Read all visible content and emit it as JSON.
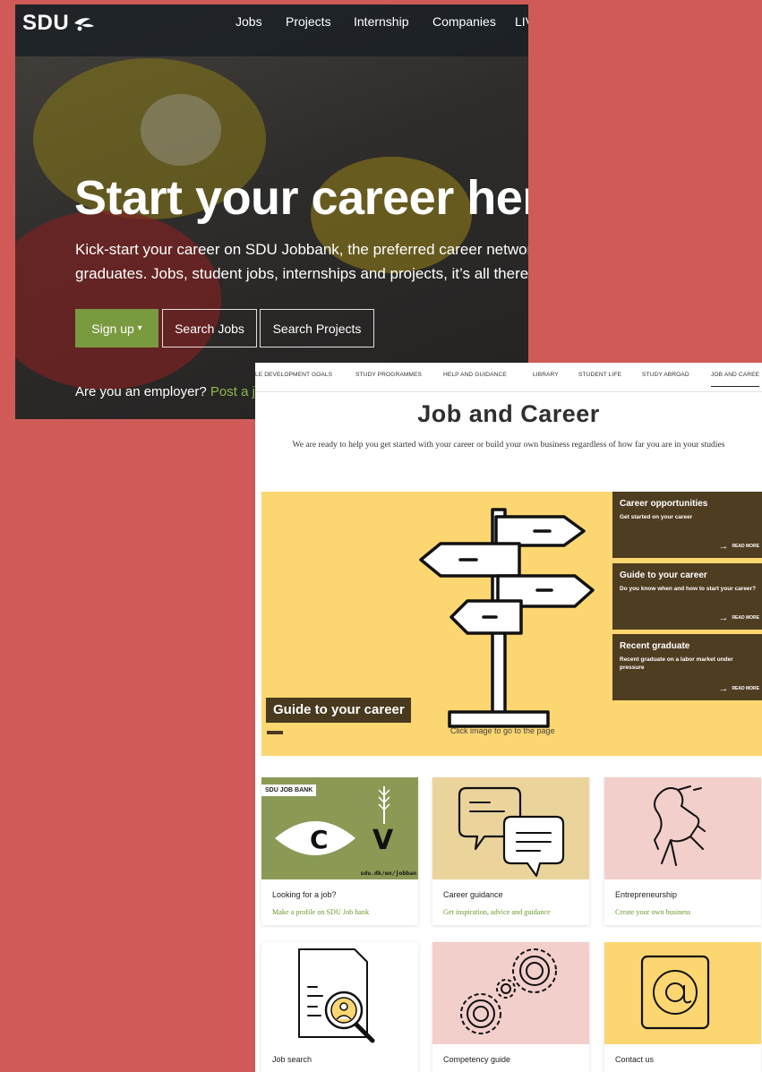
{
  "background_color": "#cf5a57",
  "jobbank": {
    "logo": "SDU",
    "logo_icon": "leaf-icon",
    "nav": [
      "Jobs",
      "Projects",
      "Internship",
      "Companies",
      "LIV"
    ],
    "title": "Start your career here",
    "subtitle_line1": "Kick-start your career on SDU Jobbank, the preferred career network",
    "subtitle_line2": "graduates. Jobs, student jobs, internships and projects, it’s all there.",
    "signup_label": "Sign up",
    "signup_caret": "▾",
    "search_jobs_label": "Search Jobs",
    "search_projects_label": "Search Projects",
    "employer_text": "Are you an employer?",
    "employer_link": "Post a jo",
    "accent_color": "#7a9a3f"
  },
  "career_page": {
    "topnav": [
      "LE DEVELOPMENT GOALS",
      "STUDY PROGRAMMES",
      "HELP AND GUIDANCE",
      "LIBRARY",
      "STUDENT LIFE",
      "STUDY ABROAD",
      "JOB AND CAREE"
    ],
    "title": "Job and Career",
    "intro": "We are ready to help you get started with your career or build your own business regardless of how far you are in your studies",
    "banner": {
      "label": "Guide to your career",
      "caption": "Click image to go to the page",
      "color": "#fcd670",
      "icon": "signpost-icon"
    },
    "side_boxes": [
      {
        "title": "Career opportunities",
        "text": "Get started on your career",
        "more": "READ MORE"
      },
      {
        "title": "Guide to your career",
        "text": "Do you know when and how to start your career?",
        "more": "READ MORE"
      },
      {
        "title": "Recent graduate",
        "text": "Recent graduate on a labor market under pressure",
        "more": "READ MORE"
      }
    ],
    "tiles": [
      {
        "title": "Looking for a job?",
        "link": "Make a profile on SDU Job bank",
        "icon": "cv-eye-icon",
        "badge": "SDU JOB BANK",
        "url_text": "sdu.dk/en/jobban",
        "cv_c": "C",
        "cv_v": "V"
      },
      {
        "title": "Career guidance",
        "link": "Get inspiration, advice and guidance",
        "icon": "speech-bubbles-icon"
      },
      {
        "title": "Entrepreneurship",
        "link": "Create your own business",
        "icon": "rearing-horse-icon"
      },
      {
        "title": "Job search",
        "link": "",
        "icon": "document-magnifier-icon"
      },
      {
        "title": "Competency guide",
        "link": "",
        "icon": "gears-icon"
      },
      {
        "title": "Contact us",
        "link": "",
        "icon": "at-sign-icon"
      }
    ]
  }
}
